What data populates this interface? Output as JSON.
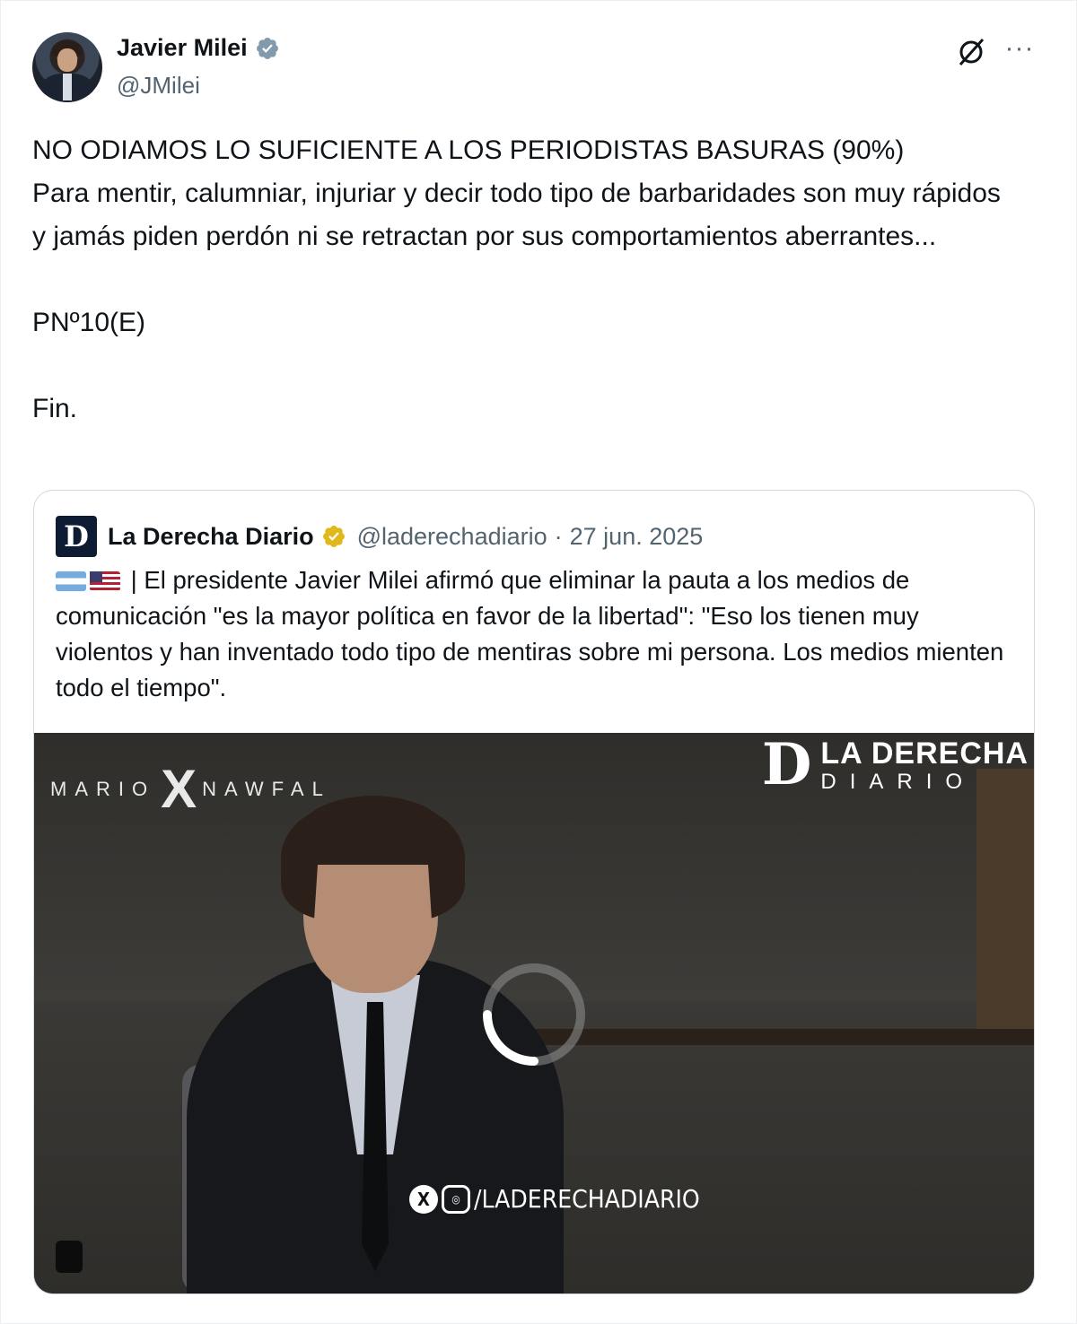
{
  "author": {
    "name": "Javier Milei",
    "handle": "@JMilei",
    "verified_color": "#829aab"
  },
  "post": {
    "text": "NO ODIAMOS LO SUFICIENTE A LOS PERIODISTAS BASURAS (90%)\nPara mentir, calumniar, injuriar y decir todo tipo de barbaridades son muy rápidos y jamás piden perdón ni se retractan por sus comportamientos aberrantes...\n\nPNº10(E)\n\nFin."
  },
  "quote": {
    "logo_letter": "D",
    "name": "La Derecha Diario",
    "verified_color": "#e2b719",
    "handle": "@laderechadiario",
    "separator": "·",
    "date": "27 jun. 2025",
    "text": " | El presidente Javier Milei afirmó que eliminar la pauta a los medios de comunicación \"es la mayor política en favor de la libertad\": \"Eso los tienen muy violentos y han inventado todo tipo de mentiras sobre mi persona. Los medios mienten todo el tiempo\".",
    "flags": [
      "argentina-flag",
      "usa-flag"
    ]
  },
  "media": {
    "watermark_left_a": "MARIO",
    "watermark_left_x": "X",
    "watermark_left_b": "NAWFAL",
    "watermark_right_logo": "D",
    "watermark_right_line1": "LA DERECHA",
    "watermark_right_line2": "DIARIO",
    "social_x": "X",
    "social_ig": "◎",
    "social_handle": "/LADERECHADIARIO",
    "state": "loading"
  },
  "icons": {
    "grok": "grok-icon",
    "more": "more-icon"
  },
  "colors": {
    "text": "#0f1419",
    "secondary": "#536471",
    "border": "#cfd9de"
  }
}
